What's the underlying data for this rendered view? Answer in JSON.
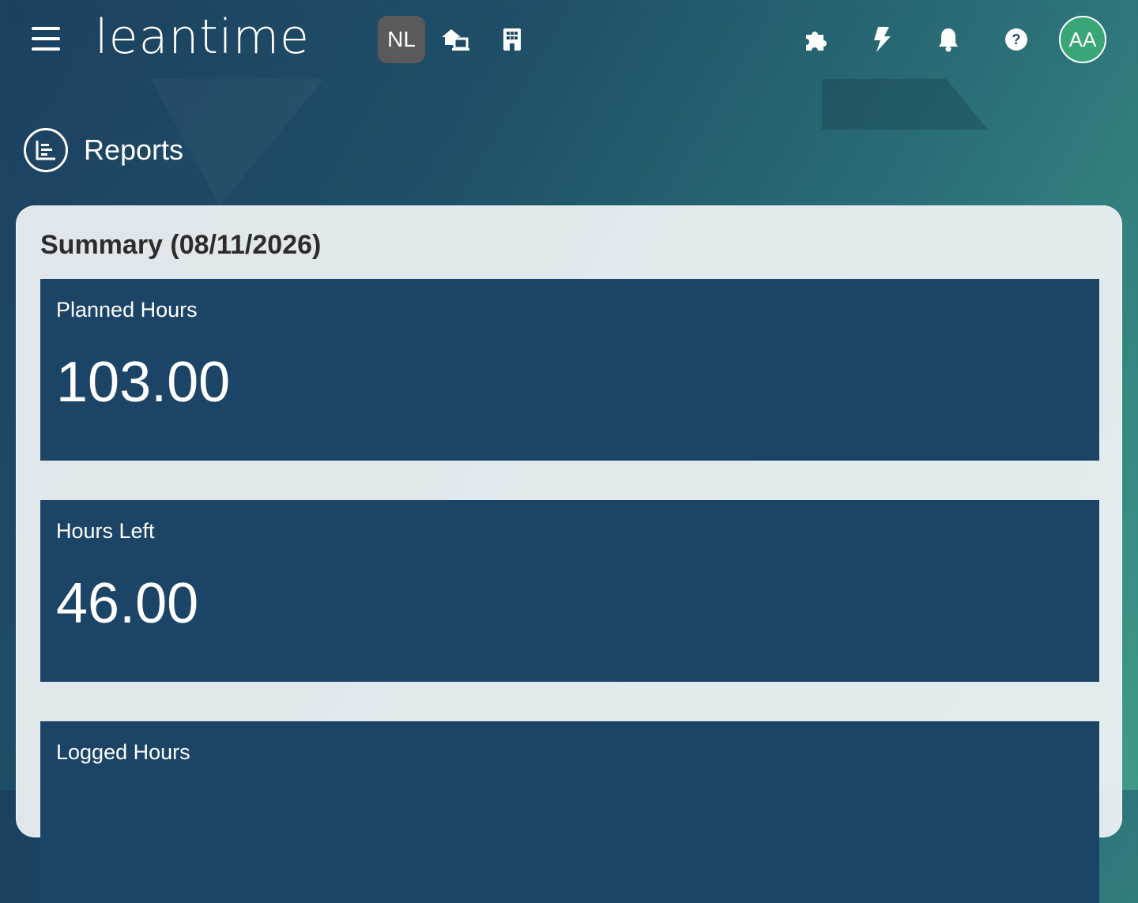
{
  "app": {
    "logo_text": "leantime",
    "project_badge": "NL",
    "user_initials": "AA"
  },
  "topbar": {
    "icons": [
      "menu-icon",
      "home-switch-icon",
      "building-icon",
      "puzzle-icon",
      "bolt-icon",
      "bell-icon",
      "help-icon"
    ]
  },
  "page": {
    "title": "Reports"
  },
  "summary": {
    "title": "Summary (08/11/2026)",
    "cards": [
      {
        "label": "Planned Hours",
        "value": "103.00"
      },
      {
        "label": "Hours Left",
        "value": "46.00"
      },
      {
        "label": "Logged Hours",
        "value": ""
      }
    ]
  },
  "colors": {
    "card_bg": "#1b4466",
    "avatar_bg": "#3aa678",
    "badge_bg": "#5a5a5a"
  }
}
